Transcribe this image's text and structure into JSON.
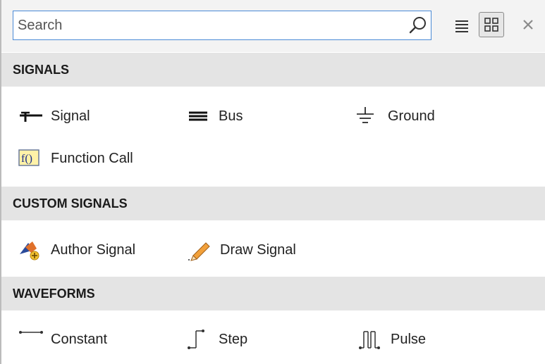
{
  "search": {
    "placeholder": "Search",
    "value": ""
  },
  "toolbar": {
    "list_view_icon": "list-view-icon",
    "grid_view_icon": "grid-view-icon",
    "close_icon": "close-icon"
  },
  "sections": [
    {
      "title": "SIGNALS",
      "items": [
        {
          "label": "Signal",
          "icon": "signal-icon"
        },
        {
          "label": "Bus",
          "icon": "bus-icon"
        },
        {
          "label": "Ground",
          "icon": "ground-icon"
        },
        {
          "label": "Function Call",
          "icon": "function-call-icon"
        }
      ]
    },
    {
      "title": "CUSTOM SIGNALS",
      "items": [
        {
          "label": "Author Signal",
          "icon": "author-signal-icon"
        },
        {
          "label": "Draw Signal",
          "icon": "pencil-icon"
        }
      ]
    },
    {
      "title": "WAVEFORMS",
      "items": [
        {
          "label": "Constant",
          "icon": "constant-icon"
        },
        {
          "label": "Step",
          "icon": "step-icon"
        },
        {
          "label": "Pulse",
          "icon": "pulse-icon"
        }
      ]
    }
  ],
  "colors": {
    "search_border": "#4a8ad6",
    "section_background": "#e4e4e4",
    "toolbar_background": "#f3f3f3",
    "function_call_icon_fill": "#fff2a8"
  }
}
